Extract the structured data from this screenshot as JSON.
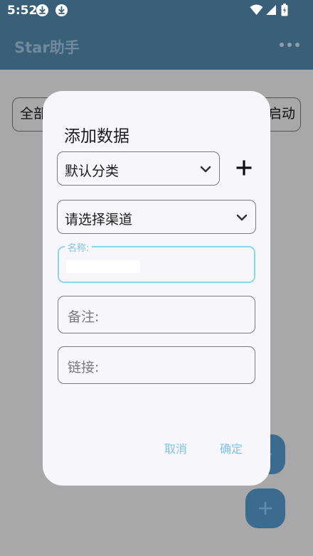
{
  "status_bar": {
    "time": "5:52"
  },
  "app_bar": {
    "title": "Star助手"
  },
  "page": {
    "chip_left": "全部",
    "chip_right": "启动"
  },
  "dialog": {
    "title": "添加数据",
    "category_value": "默认分类",
    "channel_placeholder": "请选择渠道",
    "name_label": "名称:",
    "note_placeholder": "备注:",
    "link_placeholder": "链接:",
    "cancel_label": "取消",
    "confirm_label": "确定"
  },
  "colors": {
    "app_bar": "#3a5f78",
    "accent": "#7fc4e6",
    "fab": "#3b6b8e",
    "dialog_bg": "#f7f6fb"
  },
  "icons": [
    "download-icon",
    "download-icon",
    "wifi-icon",
    "signal-icon",
    "battery-icon",
    "more-icon",
    "chevron-down-icon",
    "plus-icon"
  ]
}
